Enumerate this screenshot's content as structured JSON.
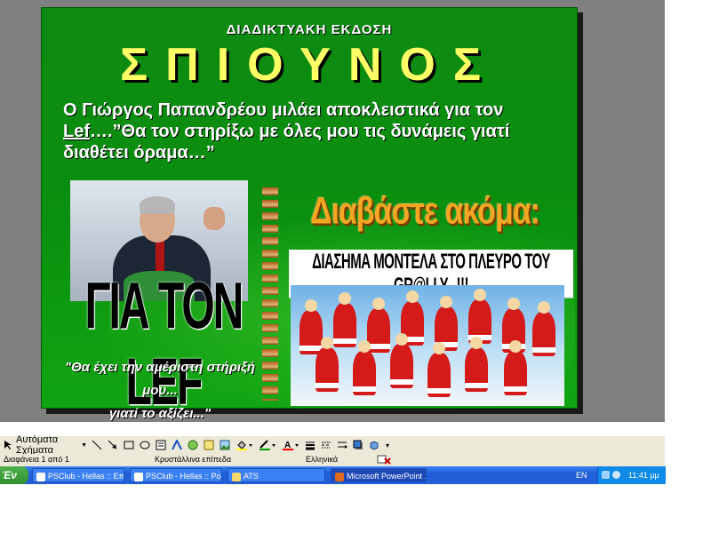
{
  "slide": {
    "kicker": "ΔΙΑΔΙΚΤΥΑΚΗ ΕΚΔΟΣΗ",
    "masthead": "ΣΠΙΟΥΝΟΣ",
    "headline_part1": "Ο Γιώργος Παπανδρέου μιλάει αποκλειστικά για τον ",
    "headline_link": "Lef",
    "headline_part2": "….”Θα τον στηρίξω με όλες μου τις δυνάμεις γιατί διαθέτει όραμα…”",
    "caption_big": "ΓΙΑ ΤΟΝ LEF",
    "quote_line1": "\"Θα έχει την αμέριστη στήριξή μου...",
    "quote_line2": "γιατί το αξίζει...\"",
    "read_more": "Διαβάστε ακόμα:",
    "article_title": "ΔΙΑΣΗΜΑ ΜΟΝΤΕΛΑ ΣΤΟ ΠΛΕΥΡΟ ΤΟΥ GR@LLY...!!!"
  },
  "toolbar": {
    "autoshapes_label": "Αυτόματα Σχήματα"
  },
  "statusbar": {
    "slide_counter": "Διαφάνεια 1 από 1",
    "design": "Κρυστάλλινα επίπεδα",
    "language": "Ελληνικά"
  },
  "taskbar": {
    "start_label": "Έν",
    "tasks": [
      {
        "label": "PSClub - Hellas :: Επε..."
      },
      {
        "label": "PSClub - Hellas :: Por..."
      },
      {
        "label": "ATS"
      },
      {
        "label": "Microsoft PowerPoint ..."
      }
    ],
    "lang_indicator": "EN",
    "clock": "11:41 μμ"
  },
  "colors": {
    "slide_green": "#0a8f0f",
    "masthead_yellow": "#ffff66",
    "read_more_orange": "#f5a623",
    "taskbar_blue": "#245edb"
  }
}
